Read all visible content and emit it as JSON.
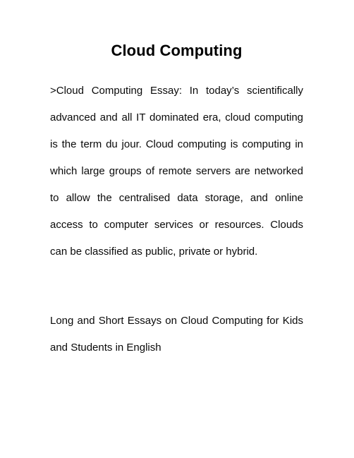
{
  "document": {
    "title": "Cloud Computing",
    "paragraphs": [
      ">Cloud Computing Essay: In today’s scientifically advanced and all IT dominated era, cloud computing is the term du jour. Cloud computing is computing in which large groups of remote servers are networked to allow the centralised data storage, and online access to computer services or resources. Clouds can be classified as public, private or hybrid.",
      "Long and Short Essays on Cloud Computing for Kids and Students in English"
    ],
    "colors": {
      "page_background": "#ffffff",
      "title_text": "#000000",
      "body_text": "#0a0a0a"
    }
  }
}
